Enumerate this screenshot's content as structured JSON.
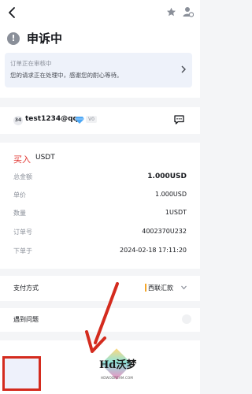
{
  "page": {
    "title": "申诉中",
    "warn_icon": "!"
  },
  "notice": {
    "line1": "订单正在审核中",
    "line2": "您的请求正在处理中，感谢您的耐心等待。"
  },
  "user": {
    "avatar_text": "34",
    "name": "test1234@qq",
    "level": "V0"
  },
  "order": {
    "side": "买入",
    "asset": "USDT",
    "rows": [
      {
        "label": "总金额",
        "value": "1.000USD"
      },
      {
        "label": "单价",
        "value": "1.000USD"
      },
      {
        "label": "数量",
        "value": "1USDT"
      },
      {
        "label": "订单号",
        "value": "4002370U232"
      },
      {
        "label": "下单于",
        "value": "2024-02-18 17:11:20"
      }
    ]
  },
  "payment": {
    "label": "支付方式",
    "value": "西联汇款"
  },
  "problem": {
    "label": "遇到问题"
  },
  "watermark": {
    "text": "Hd沃梦",
    "url": "HDWODREAM.COM"
  },
  "colors": {
    "buy": "#e0342f",
    "accent_bar": "#f4a62a",
    "annotation": "#d42b1e"
  }
}
